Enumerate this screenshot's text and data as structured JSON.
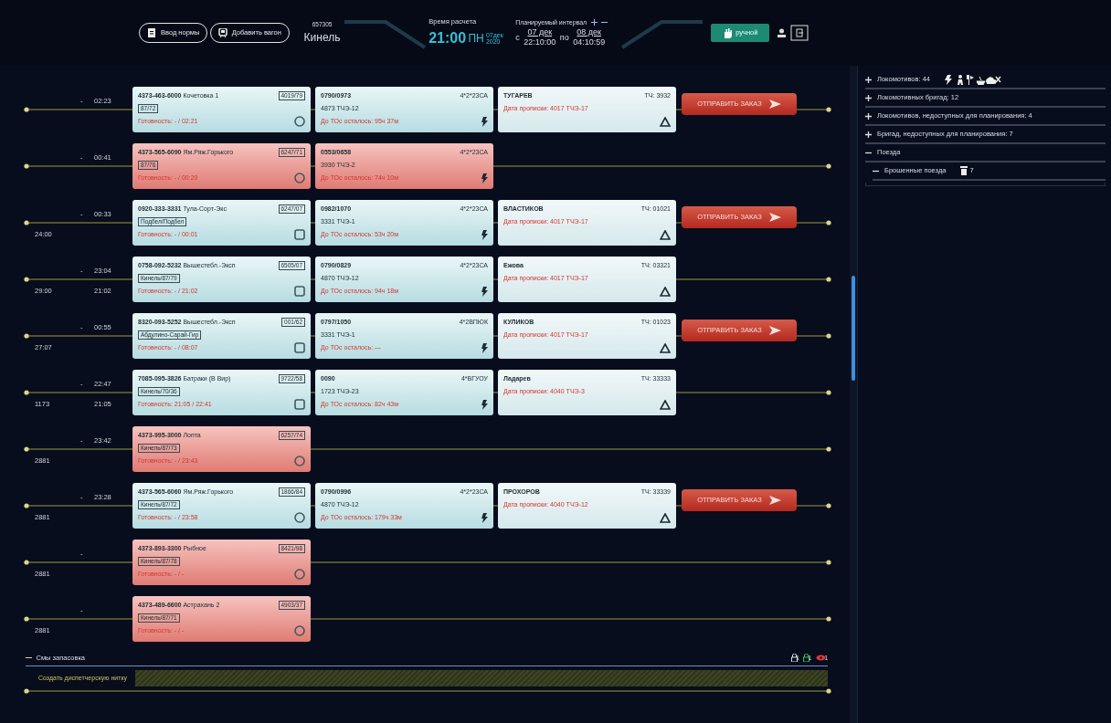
{
  "header": {
    "buttons": [
      {
        "label": "Ввод нормы"
      },
      {
        "label": "Добавить вагон"
      }
    ],
    "station": {
      "code": "657305",
      "name": "Кинель"
    },
    "calc": {
      "label": "Время расчета",
      "time": "21:00",
      "weekday": "ПН",
      "date": "07дек",
      "year": "2020"
    },
    "interval": {
      "label": "Планируемый интервал",
      "from_prefix": "с",
      "from_date": "07 дек",
      "from_time": "22:10:00",
      "to_prefix": "по",
      "to_date": "08 дек",
      "to_time": "04:10:59"
    },
    "mode_button": {
      "label": "ручной"
    }
  },
  "trains": [
    {
      "sep": "-",
      "time": "02:23",
      "alert": false,
      "number": "4373-463-6000",
      "name": "Кочетовка 1",
      "index": "4019/79",
      "tag": "87/72",
      "status": "Готовность: - / 02:21",
      "kind": "circle",
      "loco": {
        "number": "0790/0973",
        "depot": "4873 ТЧЭ-12",
        "service": "До ТОс осталось: 95ч 37м",
        "series": "4*2*23СА"
      },
      "crew": {
        "name": "ТУГАРЕВ",
        "tch": "ТЧ: 3932",
        "registration": "Дата прописки: 4017 ТЧЭ-17"
      },
      "send": "ОТПРАВИТЬ ЗАКАЗ"
    },
    {
      "sep": "-",
      "time": "00:41",
      "alert": true,
      "number": "4373-565-6090",
      "name": "Ям.Ряж.Горького",
      "index": "6247/71",
      "tag": "87/76",
      "status": "Готовность: - / 00:20",
      "kind": "circle",
      "loco": {
        "number": "0553/0658",
        "depot": "3930 ТЧЭ-2",
        "service": "До ТОс осталось: 74ч 10м",
        "series": "4*2*23СА"
      }
    },
    {
      "sep": "-",
      "time": "00:33",
      "code": "24:00",
      "alert": false,
      "number": "0920-333-3331",
      "name": "Тула-Сорт-Экс",
      "index": "6247/07",
      "tag": "Подбел/Подбел",
      "status": "Готовность: - / 00:01",
      "kind": "square",
      "loco": {
        "number": "0982/1070",
        "depot": "3331 ТЧЭ-1",
        "service": "До ТОс осталось: 53ч 20м",
        "series": "4*2*23СА"
      },
      "crew": {
        "name": "ВЛАСТИКОВ",
        "tch": "ТЧ: 01021",
        "registration": "Дата прописки: 4017 ТЧЭ-17"
      },
      "send": "ОТПРАВИТЬ ЗАКАЗ"
    },
    {
      "sep": "-",
      "time": "23:04",
      "code": "29:00",
      "time2": "21:02",
      "alert": false,
      "number": "0758-092-5232",
      "name": "Вышестебл.-Эксп",
      "index": "6505/07",
      "tag": "Кинель/87/79",
      "status": "Готовность: - / 21:02",
      "kind": "square",
      "loco": {
        "number": "0790/0829",
        "depot": "4870 ТЧЭ-12",
        "service": "До ТОс осталось: 94ч 18м",
        "series": "4*2*23СА"
      },
      "crew": {
        "name": "Ежова",
        "tch": "ТЧ: 03321",
        "registration": "Дата прописки: 4017 ТЧЭ-17"
      }
    },
    {
      "sep": "-",
      "time": "00:55",
      "code": "27:07",
      "alert": false,
      "number": "8320-093-5252",
      "name": "Вышестебл.-Эксп",
      "index": "001/62",
      "tag": "Абдулино-Сарай-Гир",
      "status": "Готовность: - / 08:07",
      "kind": "square",
      "loco": {
        "number": "0797/1050",
        "depot": "3331 ТЧЭ-1",
        "service": "До ТОс осталось: —",
        "series": "4*2ВПЮК"
      },
      "crew": {
        "name": "КУЛИКОВ",
        "tch": "ТЧ: 01023",
        "registration": "Дата прописки: 4017 ТЧЭ-17"
      },
      "send": "ОТПРАВИТЬ ЗАКАЗ"
    },
    {
      "sep": "-",
      "time": "22:47",
      "code": "1173",
      "time2": "21:05",
      "alert": false,
      "number": "7085-095-3826",
      "name": "Батраки (В Вир)",
      "index": "9722/58",
      "tag": "Кинель/70/36",
      "status": "Готовность: 21:05 / 22:41",
      "kind": "square",
      "loco": {
        "number": "0090",
        "depot": "1723 ТЧЭ-23",
        "service": "До ТОс осталось: 82ч 43м",
        "series": "4*ВГУОУ"
      },
      "crew": {
        "name": "Ладарев",
        "tch": "ТЧ: 33333",
        "registration": "Дата прописки: 4040 ТЧЭ-3"
      }
    },
    {
      "sep": "-",
      "time": "23:42",
      "code": "2881",
      "alert": true,
      "number": "4373-995-3000",
      "name": "Лопта",
      "index": "6257/74",
      "tag": "Кинель/87/73",
      "status": "Готовность: - / 23:43",
      "kind": "circle"
    },
    {
      "sep": "-",
      "time": "23:28",
      "code": "2881",
      "alert": false,
      "number": "4373-565-6060",
      "name": "Ям.Ряж.Горького",
      "index": "1866/84",
      "tag": "Кинель/87/72",
      "status": "Готовность: - / 23:58",
      "kind": "circle",
      "loco": {
        "number": "0790/0996",
        "depot": "4870 ТЧЭ-12",
        "service": "До ТОс осталось: 179ч 33м",
        "series": "4*2*23СА"
      },
      "crew": {
        "name": "ПРОХОРОВ",
        "tch": "ТЧ: 33339",
        "registration": "Дата прописки: 4040 ТЧЭ-12"
      },
      "send": "ОТПРАВИТЬ ЗАКАЗ"
    },
    {
      "sep": "-",
      "code": "2881",
      "alert": true,
      "number": "4373-893-3300",
      "name": "Рыбное",
      "index": "8421/98",
      "tag": "Кинель/87/78",
      "status": "Готовность: - / -",
      "kind": "circle"
    },
    {
      "sep": "-",
      "code": "2881",
      "alert": true,
      "number": "4373-489-6600",
      "name": "Астрахань 2",
      "index": "4903/37",
      "tag": "Кинель/87/71",
      "status": "Готовность: - / -",
      "kind": "circle"
    }
  ],
  "reserve": {
    "label": "Смы запасовка",
    "expanded": true,
    "counts": [
      "1",
      "1",
      "1"
    ]
  },
  "dispatch": {
    "label": "Создать диспетчерскую нитку"
  },
  "sidebar": {
    "items": [
      {
        "label": "Локомотивов: 44",
        "expanded": false
      },
      {
        "label": "Локомотивных бригад: 12",
        "expanded": false
      },
      {
        "label": "Локомотивов, недоступных для планирования: 4",
        "expanded": false
      },
      {
        "label": "Бригад, недоступных для планирования: 7",
        "expanded": false
      },
      {
        "label": "Поезда",
        "expanded": true,
        "children": [
          {
            "label": "Брошенные поезда",
            "expanded": true,
            "count": "7"
          }
        ]
      }
    ]
  }
}
